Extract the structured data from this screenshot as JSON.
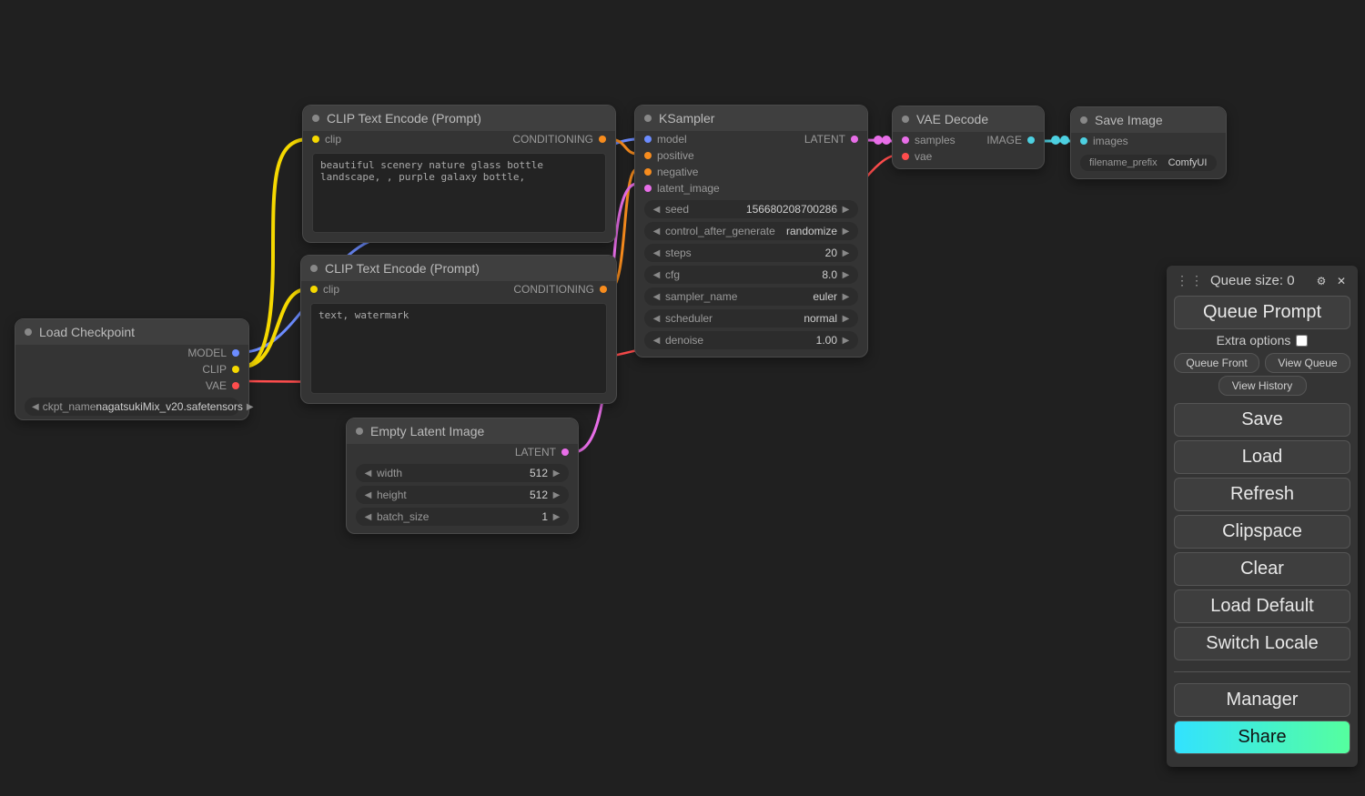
{
  "panel": {
    "queue_label": "Queue size: 0",
    "queue_prompt": "Queue Prompt",
    "extra_options": "Extra options",
    "queue_front": "Queue Front",
    "view_queue": "View Queue",
    "view_history": "View History",
    "save": "Save",
    "load": "Load",
    "refresh": "Refresh",
    "clipspace": "Clipspace",
    "clear": "Clear",
    "load_default": "Load Default",
    "switch_locale": "Switch Locale",
    "manager": "Manager",
    "share": "Share"
  },
  "nodes": {
    "load_checkpoint": {
      "title": "Load Checkpoint",
      "outputs": {
        "model": "MODEL",
        "clip": "CLIP",
        "vae": "VAE"
      },
      "widget": {
        "label": "ckpt_name",
        "value": "nagatsukiMix_v20.safetensors"
      }
    },
    "clip_pos": {
      "title": "CLIP Text Encode (Prompt)",
      "input": "clip",
      "output": "CONDITIONING",
      "text": "beautiful scenery nature glass bottle landscape, , purple galaxy bottle,"
    },
    "clip_neg": {
      "title": "CLIP Text Encode (Prompt)",
      "input": "clip",
      "output": "CONDITIONING",
      "text": "text, watermark"
    },
    "empty_latent": {
      "title": "Empty Latent Image",
      "output": "LATENT",
      "widgets": [
        {
          "label": "width",
          "value": "512"
        },
        {
          "label": "height",
          "value": "512"
        },
        {
          "label": "batch_size",
          "value": "1"
        }
      ]
    },
    "ksampler": {
      "title": "KSampler",
      "inputs": [
        "model",
        "positive",
        "negative",
        "latent_image"
      ],
      "output": "LATENT",
      "widgets": [
        {
          "label": "seed",
          "value": "156680208700286"
        },
        {
          "label": "control_after_generate",
          "value": "randomize"
        },
        {
          "label": "steps",
          "value": "20"
        },
        {
          "label": "cfg",
          "value": "8.0"
        },
        {
          "label": "sampler_name",
          "value": "euler"
        },
        {
          "label": "scheduler",
          "value": "normal"
        },
        {
          "label": "denoise",
          "value": "1.00"
        }
      ]
    },
    "vae_decode": {
      "title": "VAE Decode",
      "inputs": [
        "samples",
        "vae"
      ],
      "output": "IMAGE"
    },
    "save_image": {
      "title": "Save Image",
      "input": "images",
      "widget": {
        "label": "filename_prefix",
        "value": "ComfyUI"
      }
    }
  }
}
